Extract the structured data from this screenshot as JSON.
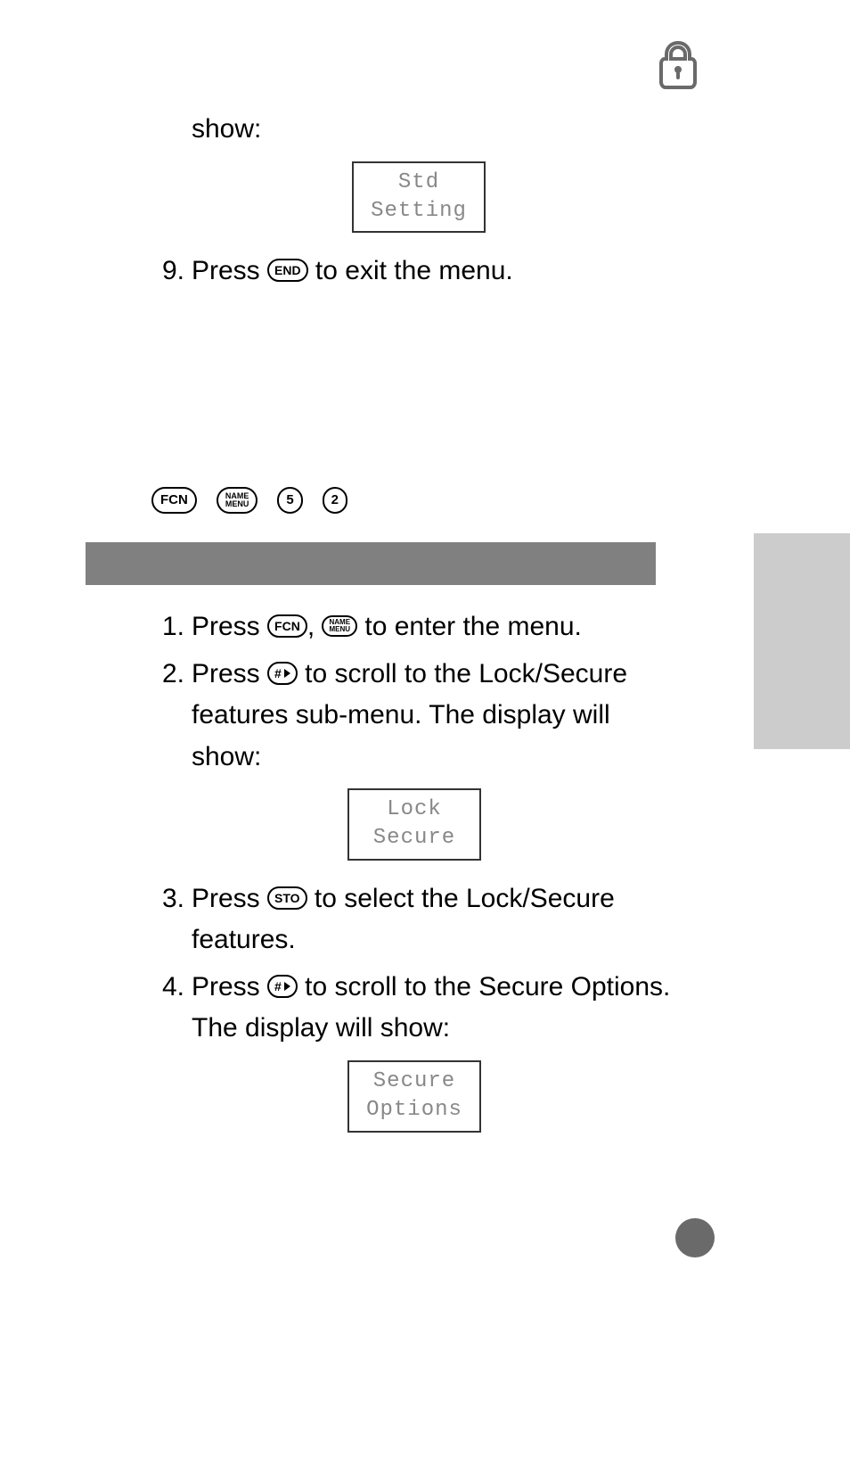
{
  "header": {
    "icon": "lock-icon"
  },
  "intro_word": "show:",
  "lcd1": {
    "line1": "Std",
    "line2": "Setting"
  },
  "step9": {
    "num": "9.",
    "before": "Press ",
    "key": "END",
    "after": " to exit the menu."
  },
  "shortcut": {
    "k1": "FCN",
    "k2_top": "NAME",
    "k2_bot": "MENU",
    "k3": "5",
    "k4": "2"
  },
  "steps": [
    {
      "num": "1.",
      "parts": [
        "Press ",
        "FCN",
        ", ",
        "NAME/MENU",
        " to enter the menu."
      ]
    },
    {
      "num": "2.",
      "before": "Press ",
      "key": "#▶",
      "after": " to scroll to the Lock/Secure features sub-menu. The display will show:"
    }
  ],
  "lcd2": {
    "line1": "Lock",
    "line2": "Secure"
  },
  "step3": {
    "num": "3.",
    "before": "Press ",
    "key": "STO",
    "after": " to select the Lock/Secure features."
  },
  "step4": {
    "num": "4.",
    "before": "Press ",
    "key": "#▶",
    "after": " to scroll to the Secure Options. The display will show:"
  },
  "lcd3": {
    "line1": "Secure",
    "line2": "Options"
  }
}
